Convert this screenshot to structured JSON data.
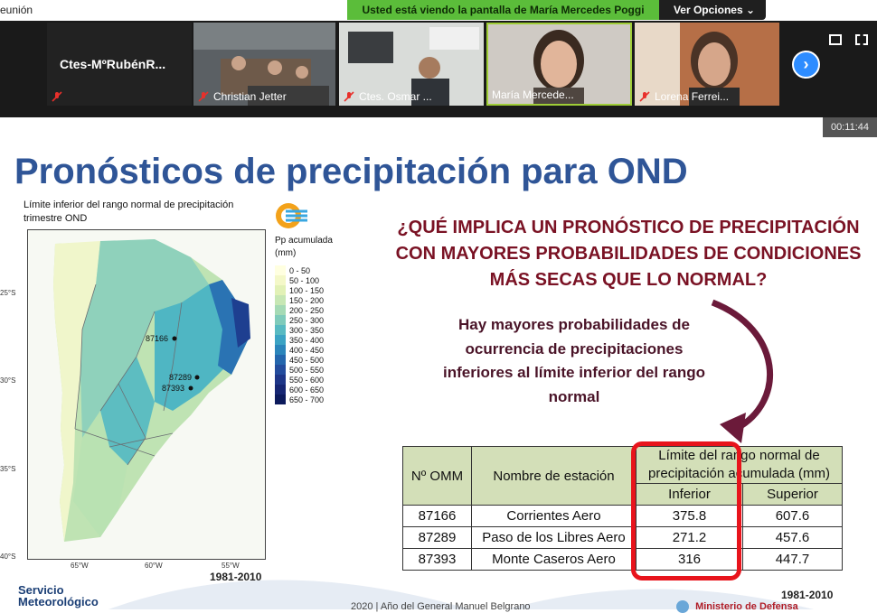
{
  "window": {
    "title": "eunión"
  },
  "share_banner": {
    "message": "Usted está viendo la pantalla de María Mercedes Poggi",
    "options_label": "Ver Opciones",
    "options_icon": "chevron-down-icon"
  },
  "participants": [
    {
      "name": "Ctes-MºRubénR...",
      "muted": true
    },
    {
      "name": "Christian Jetter",
      "muted": true
    },
    {
      "name": "Ctes. Osmar ...",
      "muted": true
    },
    {
      "name": "María Mercede...",
      "muted": false,
      "active": true
    },
    {
      "name": "Lorena Ferrei...",
      "muted": true
    }
  ],
  "meeting_timer": "00:11:44",
  "slide": {
    "title": "Pronósticos de precipitación para OND",
    "map_caption": "Límite inferior del rango normal de precipitación trimestre OND",
    "legend_title": "Pp acumulada (mm)",
    "legend": [
      {
        "label": "0 - 50",
        "color": "#ffffe0"
      },
      {
        "label": "50 - 100",
        "color": "#f4f8c8"
      },
      {
        "label": "100 - 150",
        "color": "#e2f1b6"
      },
      {
        "label": "150 - 200",
        "color": "#c7e7b4"
      },
      {
        "label": "200 - 250",
        "color": "#a5dab5"
      },
      {
        "label": "250 - 300",
        "color": "#7fcbbb"
      },
      {
        "label": "300 - 350",
        "color": "#58bac2"
      },
      {
        "label": "350 - 400",
        "color": "#3ba3c4"
      },
      {
        "label": "400 - 450",
        "color": "#2b85bb"
      },
      {
        "label": "450 - 500",
        "color": "#2466ad"
      },
      {
        "label": "500 - 550",
        "color": "#234c9d"
      },
      {
        "label": "550 - 600",
        "color": "#1e3688"
      },
      {
        "label": "600 - 650",
        "color": "#162673"
      },
      {
        "label": "650 - 700",
        "color": "#0c1a5c"
      }
    ],
    "map_lat_labels": [
      "25°S",
      "30°S",
      "35°S",
      "40°S"
    ],
    "map_lon_labels": [
      "65°W",
      "60°W",
      "55°W"
    ],
    "map_stations": [
      "87166",
      "87289",
      "87393"
    ],
    "map_period": "1981-2010",
    "question": "¿QUÉ IMPLICA UN PRONÓSTICO DE PRECIPITACIÓN CON MAYORES PROBABILIDADES DE CONDICIONES MÁS SECAS QUE LO NORMAL?",
    "answer": "Hay mayores probabilidades de ocurrencia de precipitaciones inferiores al límite inferior del rango normal",
    "table": {
      "headers": {
        "omm": "Nº OMM",
        "station": "Nombre de estación",
        "range": "Límite del rango normal de precipitación acumulada (mm)",
        "lower": "Inferior",
        "upper": "Superior"
      },
      "rows": [
        {
          "omm": "87166",
          "station": "Corrientes Aero",
          "lower": "375.8",
          "upper": "607.6"
        },
        {
          "omm": "87289",
          "station": "Paso de los Libres Aero",
          "lower": "271.2",
          "upper": "457.6"
        },
        {
          "omm": "87393",
          "station": "Monte Caseros Aero",
          "lower": "316",
          "upper": "447.7"
        }
      ]
    },
    "table_period": "1981-2010",
    "footer_left": "Servicio Meteorológico",
    "footer_mid": "2020 | Año del General Manuel Belgrano",
    "footer_right": "Ministerio de Defensa",
    "highlight_color": "#e8141c",
    "arrow_color": "#6b1a3a"
  }
}
